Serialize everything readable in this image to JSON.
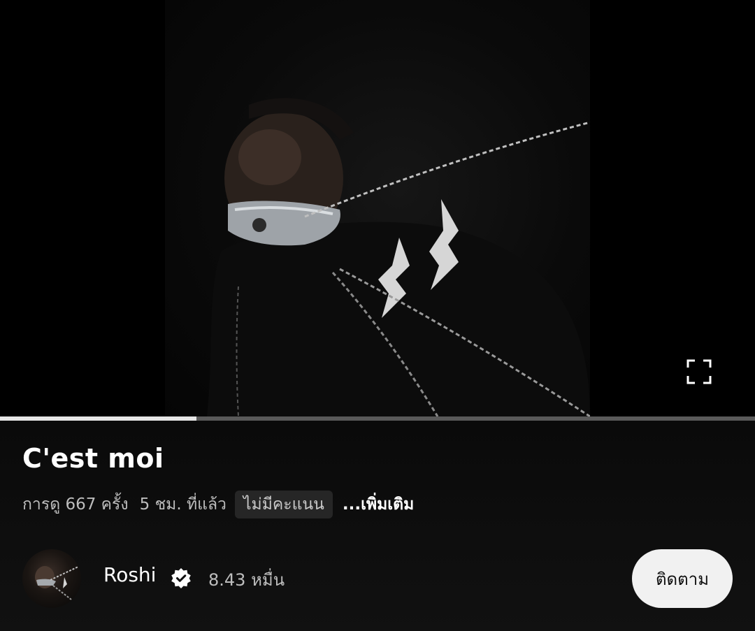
{
  "video": {
    "title": "C'est moi",
    "views": "การดู 667 ครั้ง",
    "age": "5 ชม. ที่แล้ว",
    "rating": "ไม่มีคะแนน",
    "more": "...เพิ่มเติม",
    "progress_fraction": 0.26
  },
  "channel": {
    "name": "Roshi",
    "subscribers": "8.43 หมื่น",
    "subscribe_label": "ติดตาม",
    "verified_icon": "verified-badge-icon"
  },
  "player": {
    "fullscreen_icon": "fullscreen-icon"
  },
  "colors": {
    "background": "#0b0b0b",
    "progress_fill": "#e6e6e6",
    "progress_track": "#5a5a5a",
    "subscribe_bg": "#f1f1f1"
  }
}
